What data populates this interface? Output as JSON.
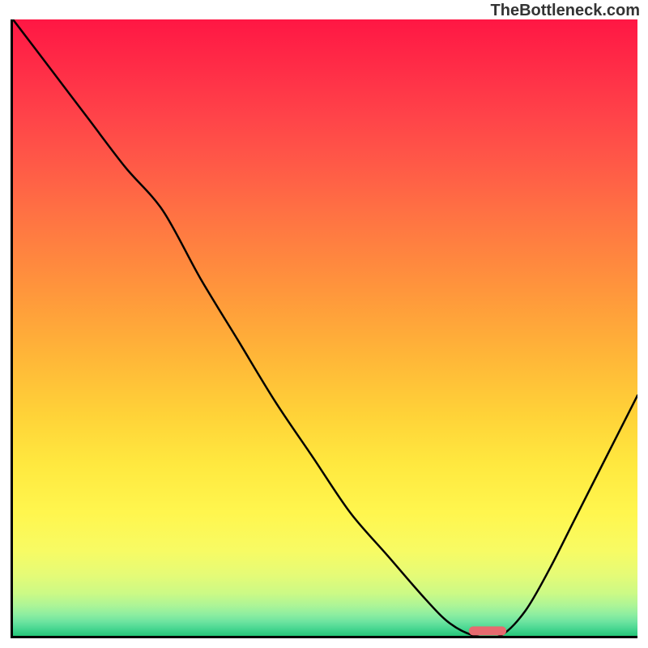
{
  "watermark": "TheBottleneck.com",
  "chart_data": {
    "type": "line",
    "title": "",
    "xlabel": "",
    "ylabel": "",
    "xlim": [
      0,
      100
    ],
    "ylim": [
      0,
      100
    ],
    "grid": false,
    "legend": false,
    "note": "Axes have no visible tick labels; x and y are normalized 0–100. Curve values estimated from pixel positions.",
    "series": [
      {
        "name": "bottleneck-curve",
        "x": [
          0,
          6,
          12,
          18,
          24,
          30,
          36,
          42,
          48,
          54,
          60,
          66,
          70,
          74,
          78,
          82,
          86,
          90,
          94,
          100
        ],
        "values": [
          100,
          92,
          84,
          76,
          69,
          58,
          48,
          38,
          29,
          20,
          13,
          6,
          2,
          0,
          0,
          4,
          11,
          19,
          27,
          39
        ]
      }
    ],
    "marker": {
      "name": "highlight-segment",
      "x_start": 73,
      "x_end": 79,
      "y": 0.8,
      "color": "#e66a6f"
    },
    "gradient_bands": [
      {
        "y": 100,
        "color": "#ff1744"
      },
      {
        "y": 92,
        "color": "#ff2d47"
      },
      {
        "y": 84,
        "color": "#ff4449"
      },
      {
        "y": 76,
        "color": "#ff5b47"
      },
      {
        "y": 68,
        "color": "#ff7343"
      },
      {
        "y": 60,
        "color": "#ff8a3e"
      },
      {
        "y": 52,
        "color": "#ffa23a"
      },
      {
        "y": 44,
        "color": "#ffba38"
      },
      {
        "y": 36,
        "color": "#ffd238"
      },
      {
        "y": 28,
        "color": "#ffe83f"
      },
      {
        "y": 20,
        "color": "#fff64e"
      },
      {
        "y": 14,
        "color": "#f8fb63"
      },
      {
        "y": 10,
        "color": "#e6fb76"
      },
      {
        "y": 7,
        "color": "#cdfa85"
      },
      {
        "y": 5,
        "color": "#aef596"
      },
      {
        "y": 3.5,
        "color": "#8eeea0"
      },
      {
        "y": 2.3,
        "color": "#6de4a0"
      },
      {
        "y": 1.3,
        "color": "#4dd893"
      },
      {
        "y": 0.5,
        "color": "#34cd83"
      },
      {
        "y": 0,
        "color": "#25c777"
      }
    ]
  }
}
